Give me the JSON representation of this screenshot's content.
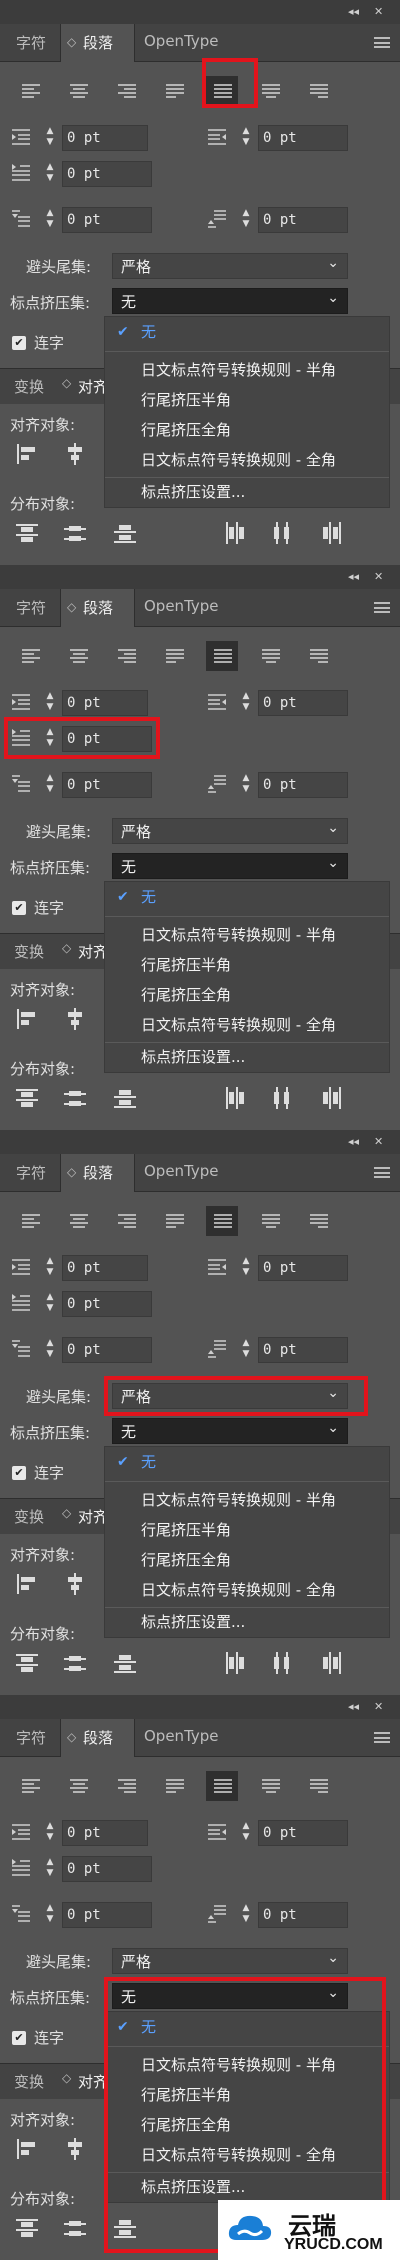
{
  "panel": {
    "tabs": [
      "字符",
      "段落",
      "OpenType"
    ],
    "tab_chevron": "◇",
    "window_controls": [
      "◂◂",
      "✕"
    ],
    "fields": {
      "left_indent": "0 pt",
      "right_indent": "0 pt",
      "first_line_indent": "0 pt",
      "space_before": "0 pt",
      "space_after": "0 pt"
    },
    "kinsoku_label": "避头尾集:",
    "kinsoku_value": "严格",
    "mojikumi_label": "标点挤压集:",
    "mojikumi_value": "无",
    "hyphenate_label": "连字",
    "hyphenate_checked": true,
    "partial_labels": {
      "transform_tab": "变换",
      "align_tab": "对齐",
      "align_to": "对齐对象:",
      "distribute": "分布对象:"
    },
    "mojikumi_options": [
      "无",
      "日文标点符号转换规则 - 半角",
      "行尾挤压半角",
      "行尾挤压全角",
      "日文标点符号转换规则 - 全角",
      "标点挤压设置..."
    ],
    "checked_option_index": 0
  },
  "steps": [
    {
      "highlight": "justify-all-button"
    },
    {
      "highlight": "first-line-indent-field"
    },
    {
      "highlight": "kinsoku-select"
    },
    {
      "highlight": "mojikumi-select-and-dropdown"
    }
  ],
  "icons": {
    "spinner": "up-down-arrows-icon",
    "checkmark": "checkmark-icon",
    "chevron": "chevron-down-icon"
  },
  "colors": {
    "panel_bg": "#535353",
    "highlight_red": "#e2141c",
    "accent_blue": "#5aa0ff"
  },
  "watermark": {
    "cn": "云瑞",
    "en": "YRUCD.COM"
  }
}
